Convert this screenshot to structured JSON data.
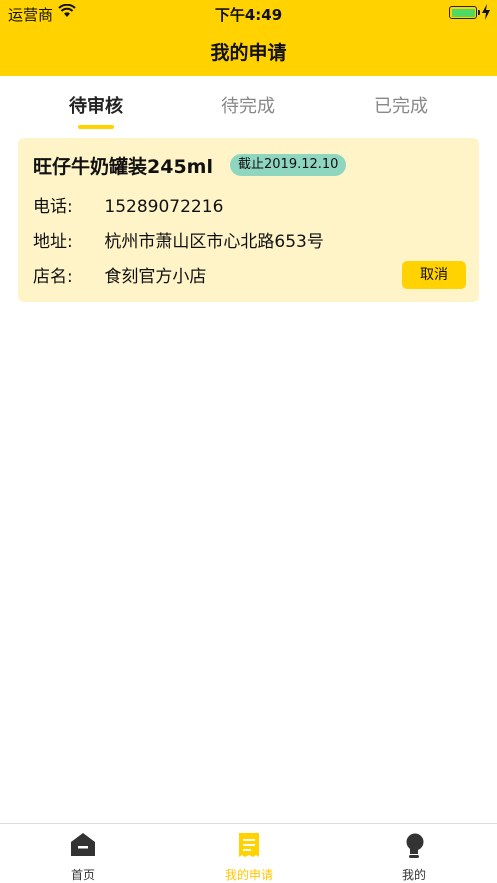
{
  "status_bar": {
    "carrier": "运营商",
    "time": "下午4:49"
  },
  "nav": {
    "title": "我的申请"
  },
  "tabs": [
    {
      "label": "待审核",
      "active": true
    },
    {
      "label": "待完成",
      "active": false
    },
    {
      "label": "已完成",
      "active": false
    }
  ],
  "card": {
    "product": "旺仔牛奶罐装245ml",
    "deadline": "截止2019.12.10",
    "phone_label": "电话:",
    "phone": "15289072216",
    "address_label": "地址:",
    "address": "杭州市萧山区市心北路653号",
    "shop_label": "店名:",
    "shop": "食刻官方小店",
    "cancel_label": "取消"
  },
  "tab_bar": [
    {
      "label": "首页",
      "icon": "home-icon",
      "active": false
    },
    {
      "label": "我的申请",
      "icon": "receipt-icon",
      "active": true
    },
    {
      "label": "我的",
      "icon": "profile-icon",
      "active": false
    }
  ],
  "colors": {
    "accent": "#FFD200",
    "card_bg": "#FFF4C8",
    "badge_bg": "#8FD6C0"
  }
}
